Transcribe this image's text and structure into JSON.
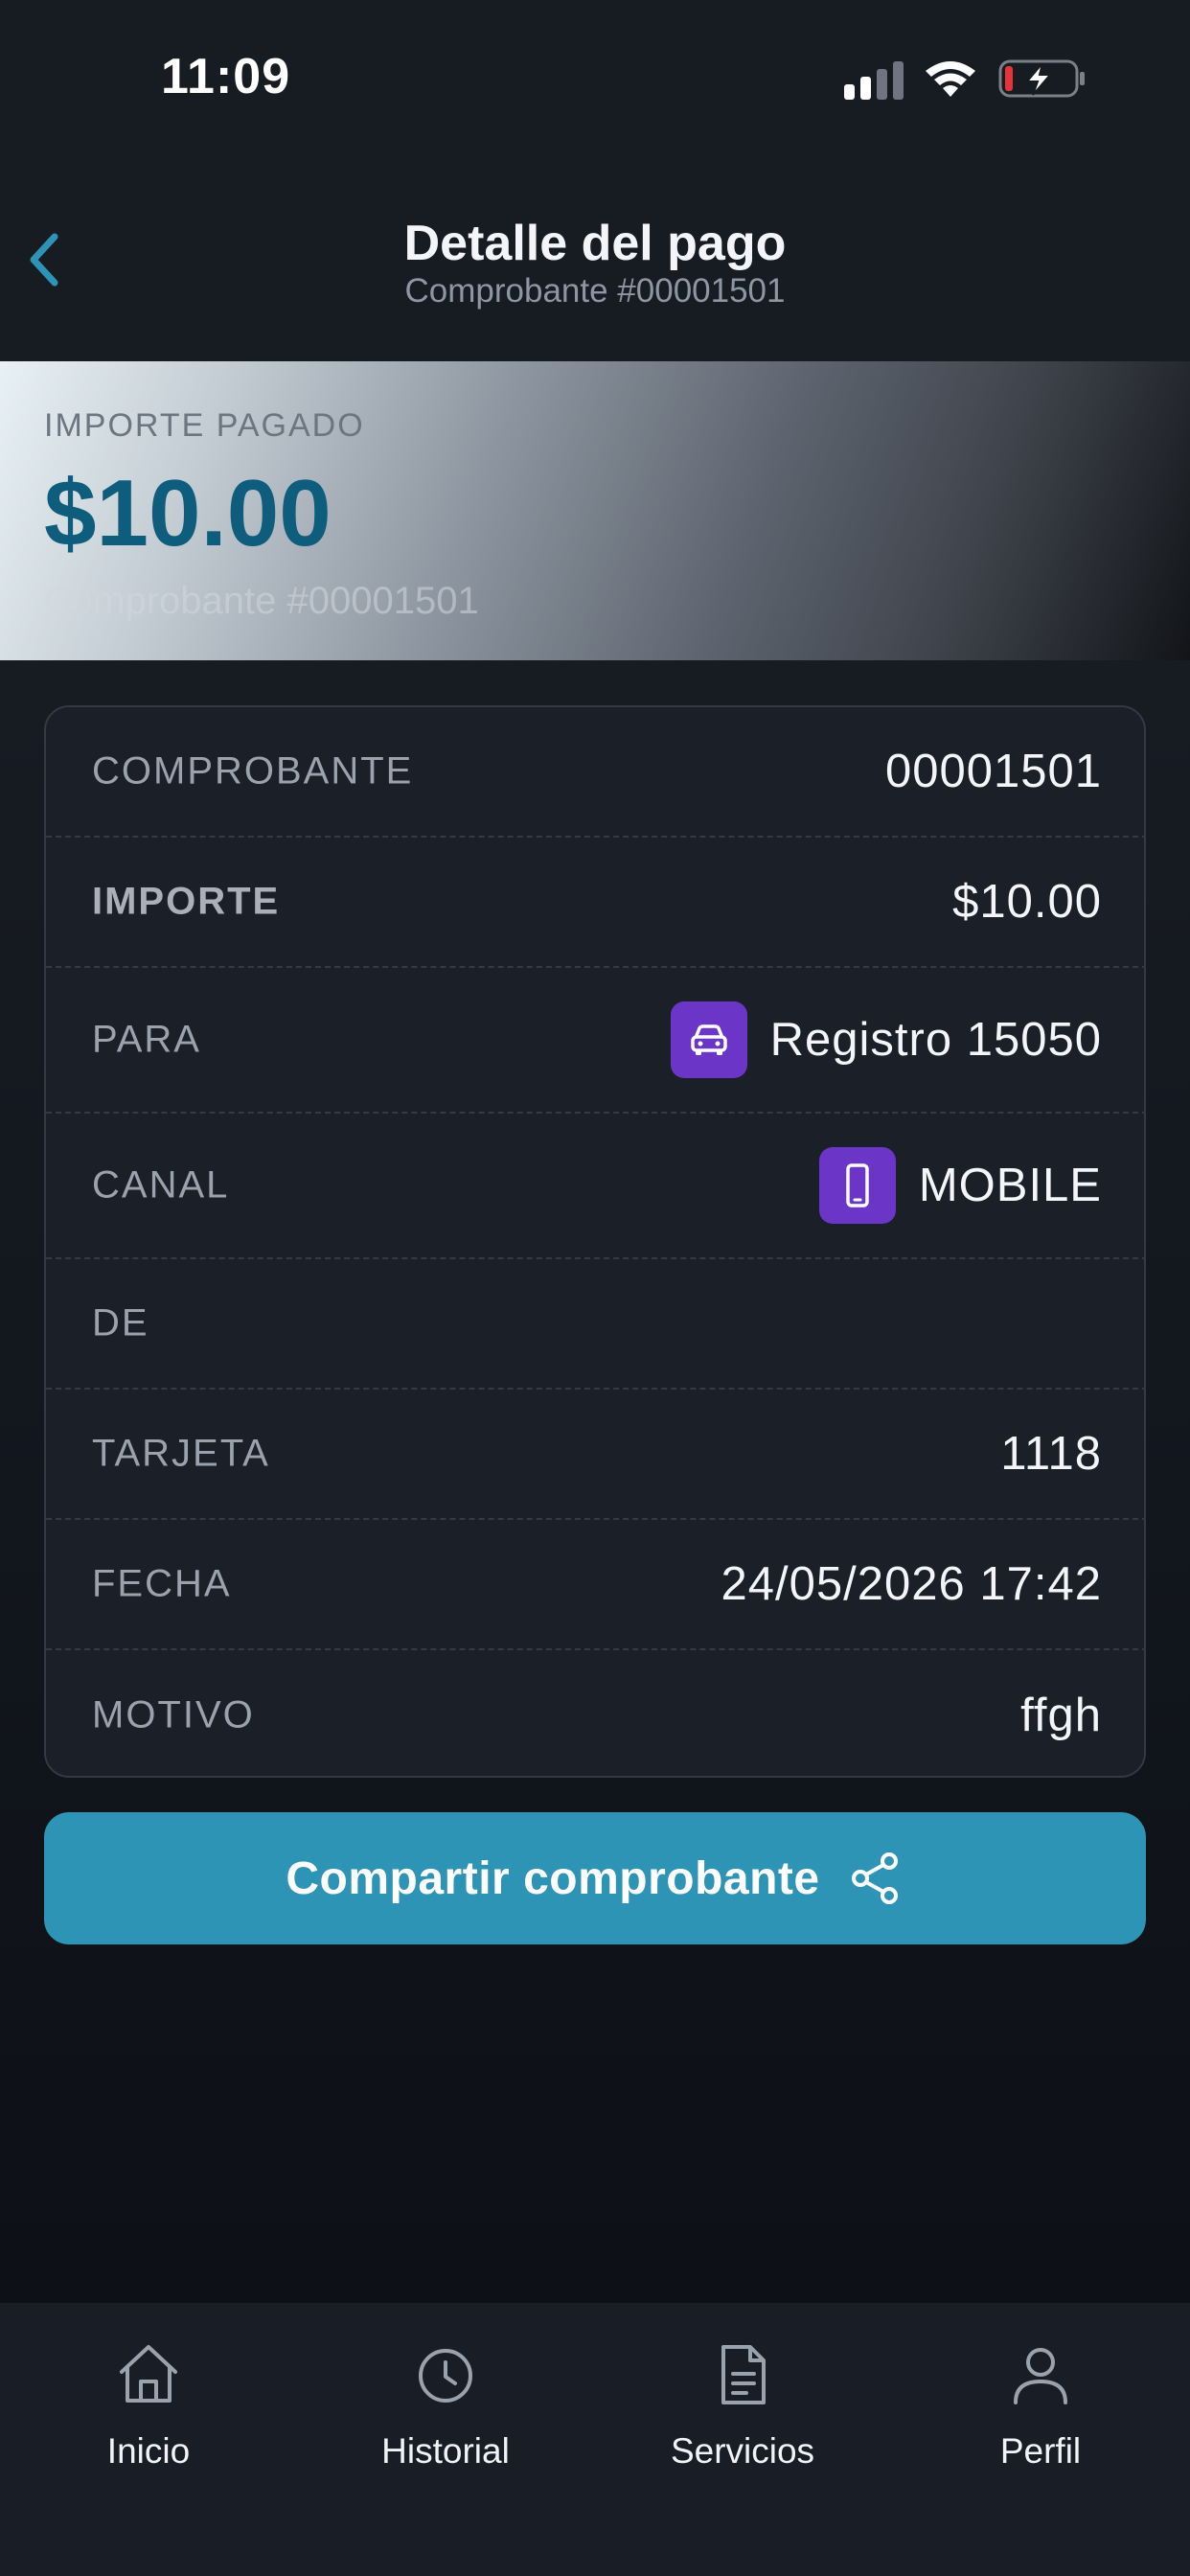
{
  "status_bar": {
    "time": "11:09",
    "icons": [
      "signal-icon",
      "wifi-icon",
      "battery-charging-icon"
    ],
    "battery_level_color": "#e5333a"
  },
  "header": {
    "back_icon": "chevron-left-icon",
    "title": "Detalle del pago",
    "subtitle": "Comprobante #00001501",
    "accent_color": "#2e94b5"
  },
  "amount_banner": {
    "label": "IMPORTE PAGADO",
    "amount": "$10.00",
    "reference": "Comprobante #00001501",
    "amount_color": "#0f5d7c"
  },
  "details": [
    {
      "label": "COMPROBANTE",
      "value": "00001501",
      "icon": null
    },
    {
      "label": "IMPORTE",
      "value": "$10.00",
      "icon": null
    },
    {
      "label": "PARA",
      "value": "Registro 15050",
      "icon": "car-icon"
    },
    {
      "label": "CANAL",
      "value": "MOBILE",
      "icon": "smartphone-icon"
    },
    {
      "label": "DE",
      "value": "",
      "icon": null
    },
    {
      "label": "TARJETA",
      "value": "1118",
      "icon": null
    },
    {
      "label": "FECHA",
      "value": "24/05/2026 17:42",
      "icon": null
    },
    {
      "label": "MOTIVO",
      "value": "ffgh",
      "icon": null
    }
  ],
  "share_button": {
    "label": "Compartir comprobante",
    "icon": "share-icon",
    "color": "#2e94b5"
  },
  "bottom_nav": {
    "items": [
      {
        "label": "Inicio",
        "icon": "home-icon"
      },
      {
        "label": "Historial",
        "icon": "clock-icon"
      },
      {
        "label": "Servicios",
        "icon": "document-icon"
      },
      {
        "label": "Perfil",
        "icon": "user-icon"
      }
    ]
  },
  "colors": {
    "background": "#171b22",
    "card": "#1b1f27",
    "badge": "#6b35c7"
  }
}
